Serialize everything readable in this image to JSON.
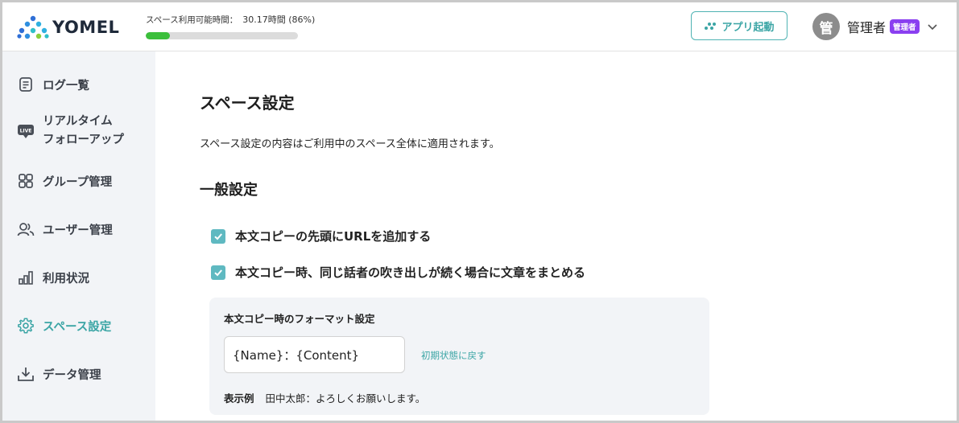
{
  "header": {
    "logo_text": "YOMEL",
    "usage_label": "スペース利用可能時間：",
    "usage_value": "30.17時間 (86%)",
    "usage_percent": 86,
    "app_button_label": "アプリ起動",
    "user_name": "管理者",
    "avatar_text": "管",
    "role_badge": "管理者"
  },
  "sidebar": {
    "items": [
      {
        "icon": "document-icon",
        "label": "ログ一覧"
      },
      {
        "icon": "live-icon",
        "label_line1": "リアルタイム",
        "label_line2": "フォローアップ",
        "live_text": "LIVE"
      },
      {
        "icon": "grid-icon",
        "label": "グループ管理"
      },
      {
        "icon": "users-icon",
        "label": "ユーザー管理"
      },
      {
        "icon": "bar-chart-icon",
        "label": "利用状況"
      },
      {
        "icon": "gear-icon",
        "label": "スペース設定",
        "active": true
      },
      {
        "icon": "download-icon",
        "label": "データ管理"
      }
    ]
  },
  "main": {
    "title": "スペース設定",
    "description": "スペース設定の内容はご利用中のスペース全体に適用されます。",
    "section_title": "一般設定",
    "checkboxes": [
      {
        "label": "本文コピーの先頭にURLを追加する",
        "checked": true
      },
      {
        "label": "本文コピー時、同じ話者の吹き出しが続く場合に文章をまとめる",
        "checked": true
      }
    ],
    "format": {
      "title": "本文コピー時のフォーマット設定",
      "input_value": "{Name}：{Content}",
      "reset_label": "初期状態に戻す",
      "example_label": "表示例",
      "example_text": "田中太郎：よろしくお願いします。"
    }
  },
  "colors": {
    "accent": "#3ba5a5",
    "checkbox": "#5fb9c1",
    "progress": "#3bbf3b",
    "badge": "#8a3ff0",
    "sidebar_bg": "#f2f4f7"
  }
}
